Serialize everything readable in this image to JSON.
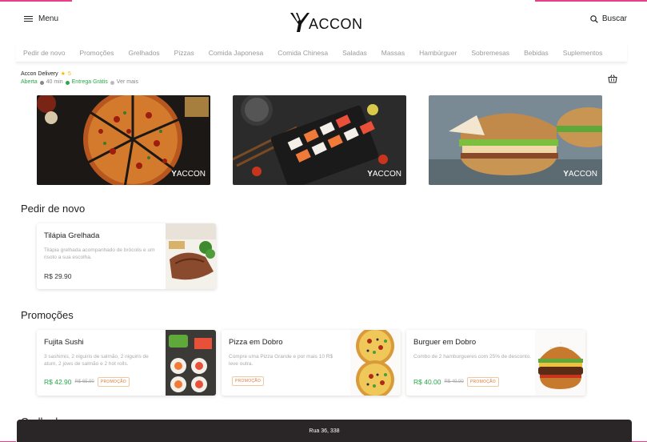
{
  "header": {
    "menu_label": "Menu",
    "logo_text": "ACCON",
    "search_label": "Buscar"
  },
  "categories": [
    "Pedir de novo",
    "Promoções",
    "Grelhados",
    "Pizzas",
    "Comida Japonesa",
    "Comida Chinesa",
    "Saladas",
    "Massas",
    "Hambúrguer",
    "Sobremesas",
    "Bebidas",
    "Suplementos"
  ],
  "store": {
    "name": "Accon Delivery",
    "rating": "5",
    "status": "Aberta",
    "time": "40 min",
    "delivery": "Entrega Grátis",
    "more": "Ver mais"
  },
  "banners": [
    {
      "subject": "pizza",
      "mark": "ACCON"
    },
    {
      "subject": "sushi",
      "mark": "ACCON"
    },
    {
      "subject": "sandwich",
      "mark": "ACCON"
    }
  ],
  "sections": {
    "reorder_title": "Pedir de novo",
    "promos_title": "Promoções",
    "next_title": "Grelhados"
  },
  "reorder_items": [
    {
      "title": "Tilápia Grelhada",
      "desc": "Tilápia grelhada acompanhado de brócolis e um risoto a sua escolha.",
      "price": "R$ 29.90"
    }
  ],
  "promo_items": [
    {
      "title": "Fujita Sushi",
      "desc": "3 sashimis, 2 niguiris de salmão, 2 niguiris de atum, 2 jows de salmão e 2 hot rolls.",
      "price": "R$ 42.90",
      "old_price": "R$ 65.90",
      "tag": "PROMOÇÃO"
    },
    {
      "title": "Pizza em Dobro",
      "desc": "Compre uma Pizza Grande e por mais 10 R$ leve outra.",
      "price": "",
      "old_price": "",
      "tag": "PROMOÇÃO"
    },
    {
      "title": "Burguer em Dobro",
      "desc": "Combo de 2 hamburgueres com 25% de desconto.",
      "price": "R$ 40.00",
      "old_price": "R$ 49.90",
      "tag": "PROMOÇÃO"
    }
  ],
  "footer": {
    "address": "Rua 36, 338"
  },
  "colors": {
    "accent": "#e83e8c",
    "promo_green": "#2aa84a",
    "promo_tag": "#e0783a",
    "star": "#f5b800",
    "address_bar": "#2a2527"
  }
}
